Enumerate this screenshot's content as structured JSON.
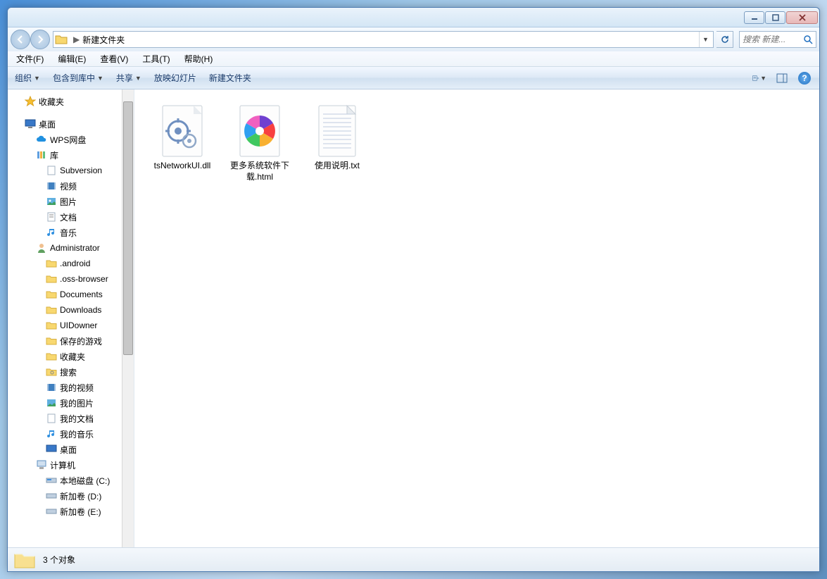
{
  "breadcrumb": {
    "current": "新建文件夹"
  },
  "search": {
    "placeholder": "搜索 新建..."
  },
  "menubar": [
    {
      "label": "文件(F)"
    },
    {
      "label": "编辑(E)"
    },
    {
      "label": "查看(V)"
    },
    {
      "label": "工具(T)"
    },
    {
      "label": "帮助(H)"
    }
  ],
  "toolbar": {
    "organize": "组织",
    "include": "包含到库中",
    "share": "共享",
    "slideshow": "放映幻灯片",
    "newfolder": "新建文件夹"
  },
  "sidebar": {
    "favorites": "收藏夹",
    "desktop": "桌面",
    "wps": "WPS网盘",
    "library": "库",
    "subversion": "Subversion",
    "video": "视频",
    "pictures": "图片",
    "documents": "文档",
    "music": "音乐",
    "admin": "Administrator",
    "android": ".android",
    "oss": ".oss-browser",
    "docs": "Documents",
    "downloads": "Downloads",
    "uidowner": "UIDowner",
    "savedgames": "保存的游戏",
    "favs": "收藏夹",
    "search": "搜索",
    "myvideo": "我的视频",
    "mypics": "我的图片",
    "mydocs": "我的文档",
    "mymusic": "我的音乐",
    "desk2": "桌面",
    "computer": "计算机",
    "cdrive": "本地磁盘 (C:)",
    "ddrive": "新加卷 (D:)",
    "edrive": "新加卷 (E:)"
  },
  "files": [
    {
      "name": "tsNetworkUI.dll",
      "type": "dll"
    },
    {
      "name": "更多系统软件下载.html",
      "type": "html"
    },
    {
      "name": "使用说明.txt",
      "type": "txt"
    }
  ],
  "status": {
    "count": "3 个对象"
  }
}
